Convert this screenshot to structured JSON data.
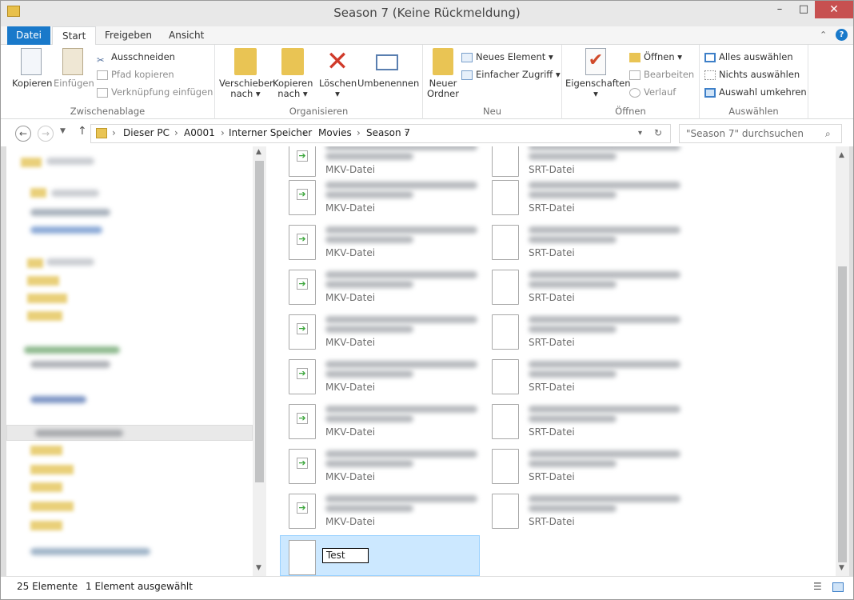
{
  "window": {
    "title": "Season 7 (Keine Rückmeldung)",
    "minimize_icon": "minimize-icon",
    "maximize_icon": "maximize-icon",
    "close_icon": "close-icon",
    "close_glyph": "✕"
  },
  "ribbon_tabs": [
    "Datei",
    "Start",
    "Freigeben",
    "Ansicht"
  ],
  "ribbon": {
    "clipboard": {
      "label": "Zwischenablage",
      "copy": "Kopieren",
      "paste": "Einfügen",
      "cut": "Ausschneiden",
      "copy_path": "Pfad kopieren",
      "paste_shortcut": "Verknüpfung einfügen"
    },
    "organize": {
      "label": "Organisieren",
      "move_to_1": "Verschieben",
      "move_to_2": "nach",
      "copy_to_1": "Kopieren",
      "copy_to_2": "nach",
      "delete": "Löschen",
      "rename": "Umbenennen"
    },
    "new": {
      "label": "Neu",
      "new_folder_1": "Neuer",
      "new_folder_2": "Ordner",
      "new_item": "Neues Element",
      "easy_access": "Einfacher Zugriff"
    },
    "open": {
      "label": "Öffnen",
      "properties": "Eigenschaften",
      "open": "Öffnen",
      "edit": "Bearbeiten",
      "history": "Verlauf"
    },
    "select": {
      "label": "Auswählen",
      "select_all": "Alles auswählen",
      "select_none": "Nichts auswählen",
      "invert": "Auswahl umkehren"
    }
  },
  "address": {
    "path": [
      "Dieser PC",
      "A0001",
      "Interner Speicher",
      "Movies",
      "Season 7"
    ],
    "search_placeholder": "\"Season 7\" durchsuchen"
  },
  "files": {
    "mkv_type": "MKV-Datei",
    "srt_type": "SRT-Datei",
    "rename_value": "Test"
  },
  "status": {
    "count": "25 Elemente",
    "selected": "1 Element ausgewählt"
  },
  "colors": {
    "accent": "#1979ca",
    "selection": "#cce8ff",
    "close": "#c75050"
  }
}
